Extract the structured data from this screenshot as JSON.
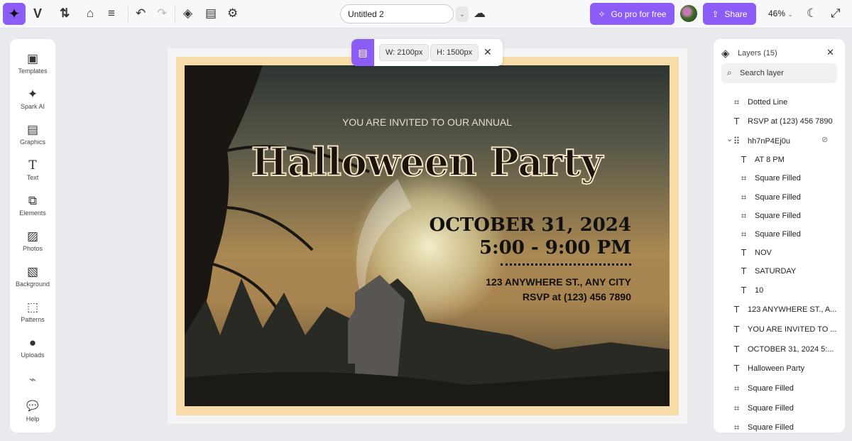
{
  "topbar": {
    "title": "Untitled 2",
    "go_pro": "Go pro for free",
    "share": "Share",
    "zoom": "46%"
  },
  "sidebar": [
    {
      "label": "Templates",
      "icon": "▣"
    },
    {
      "label": "Spark AI",
      "icon": "✦"
    },
    {
      "label": "Graphics",
      "icon": "▤"
    },
    {
      "label": "Text",
      "icon": "T"
    },
    {
      "label": "Elements",
      "icon": "⧉"
    },
    {
      "label": "Photos",
      "icon": "▨"
    },
    {
      "label": "Background",
      "icon": "▧"
    },
    {
      "label": "Patterns",
      "icon": "⬚"
    },
    {
      "label": "Uploads",
      "icon": "●"
    },
    {
      "label": "",
      "icon": "⌁"
    },
    {
      "label": "Help",
      "icon": "💬"
    }
  ],
  "size": {
    "width": "W: 2100px",
    "height": "H: 1500px"
  },
  "design": {
    "invited": "YOU ARE INVITED TO OUR ANNUAL",
    "title": "Halloween Party",
    "date": "OCTOBER 31, 2024",
    "time": "5:00 - 9:00 PM",
    "address": "123 ANYWHERE ST., ANY CITY",
    "rsvp": "RSVP at (123) 456 7890"
  },
  "layers": {
    "title": "Layers (15)",
    "search_placeholder": "Search layer",
    "items": [
      {
        "icon": "frame",
        "label": "Dotted Line",
        "level": 0
      },
      {
        "icon": "text",
        "label": "RSVP at (123) 456 7890",
        "level": 0
      },
      {
        "icon": "group",
        "label": "hh7nP4Ej0u",
        "level": 0
      },
      {
        "icon": "text",
        "label": "AT 8 PM",
        "level": 1
      },
      {
        "icon": "frame",
        "label": "Square Filled",
        "level": 1
      },
      {
        "icon": "frame",
        "label": "Square Filled",
        "level": 1
      },
      {
        "icon": "frame",
        "label": "Square Filled",
        "level": 1
      },
      {
        "icon": "frame",
        "label": "Square Filled",
        "level": 1
      },
      {
        "icon": "text",
        "label": "NOV",
        "level": 1
      },
      {
        "icon": "text",
        "label": "SATURDAY",
        "level": 1
      },
      {
        "icon": "text",
        "label": "10",
        "level": 1
      },
      {
        "icon": "text",
        "label": "123 ANYWHERE ST., A...",
        "level": 0
      },
      {
        "icon": "text",
        "label": "YOU ARE INVITED TO ...",
        "level": 0
      },
      {
        "icon": "text",
        "label": "OCTOBER 31, 2024 5:...",
        "level": 0
      },
      {
        "icon": "text",
        "label": "Halloween Party",
        "level": 0
      },
      {
        "icon": "frame",
        "label": "Square Filled",
        "level": 0
      },
      {
        "icon": "frame",
        "label": "Square Filled",
        "level": 0
      },
      {
        "icon": "frame",
        "label": "Square Filled",
        "level": 0
      }
    ]
  }
}
